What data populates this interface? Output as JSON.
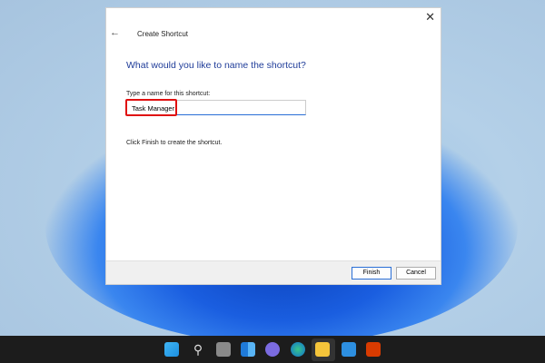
{
  "dialog": {
    "title": "Create Shortcut",
    "heading": "What would you like to name the shortcut?",
    "field_label": "Type a name for this shortcut:",
    "field_value": "Task Manager",
    "info": "Click Finish to create the shortcut.",
    "finish": "Finish",
    "cancel": "Cancel",
    "close_icon": "close-icon",
    "back_icon": "back-arrow-icon"
  },
  "taskbar": {
    "icons": [
      "start-icon",
      "search-icon",
      "task-view-icon",
      "widgets-icon",
      "teams-chat-icon",
      "edge-icon",
      "file-explorer-icon",
      "mail-icon",
      "office-icon"
    ],
    "active": "file-explorer-icon"
  },
  "colors": {
    "highlight": "#e01010",
    "heading": "#1f3c99",
    "accent": "#2a6fd6"
  }
}
